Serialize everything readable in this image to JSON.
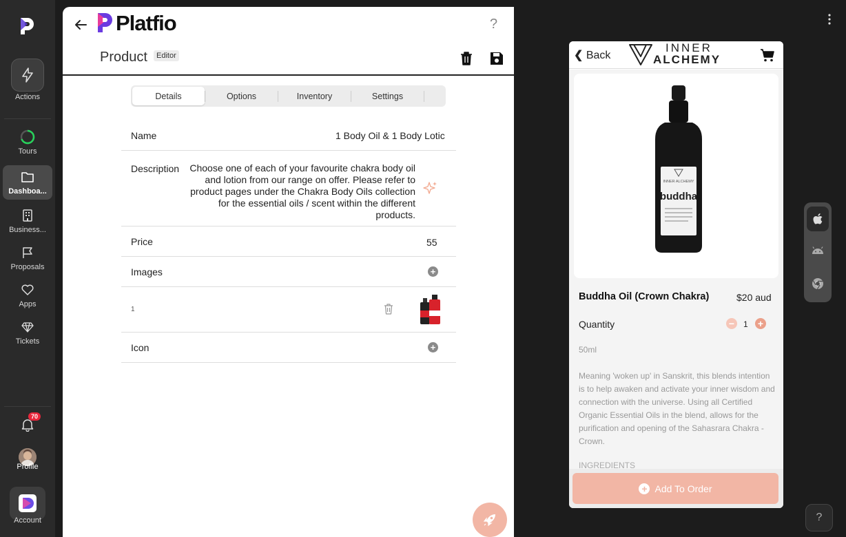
{
  "app": {
    "name": "Platfio"
  },
  "sidebar": {
    "items": [
      {
        "label": "Actions",
        "icon": "lightning-icon"
      },
      {
        "label": "Tours",
        "icon": "progress-ring-icon"
      },
      {
        "label": "Dashboa...",
        "icon": "folder-icon"
      },
      {
        "label": "Business...",
        "icon": "building-icon"
      },
      {
        "label": "Proposals",
        "icon": "flag-icon"
      },
      {
        "label": "Apps",
        "icon": "heart-icon"
      },
      {
        "label": "Tickets",
        "icon": "diamond-icon"
      }
    ],
    "notifications_count": "70",
    "profile_label": "Profile",
    "account_label": "Account"
  },
  "editor": {
    "title": "Product",
    "tag": "Editor",
    "help": "?",
    "tabs": [
      {
        "label": "Details"
      },
      {
        "label": "Options"
      },
      {
        "label": "Inventory"
      },
      {
        "label": "Settings"
      }
    ],
    "fields": {
      "name_label": "Name",
      "name_value": "1 Body Oil & 1 Body Lotic",
      "description_label": "Description",
      "description_value": "Choose one of each of your favourite chakra body oil and lotion from our range on offer. Please refer to product pages under the Chakra Body Oils collection for the essential oils / scent within the different products.",
      "price_label": "Price",
      "price_value": "55",
      "images_label": "Images",
      "image_index": "1",
      "icon_label": "Icon"
    }
  },
  "preview": {
    "back": "Back",
    "brand_line1": "INNER",
    "brand_line2": "ALCHEMY",
    "bottle_brand": "INNER ALCHEMY",
    "bottle_name": "buddha",
    "product_name": "Buddha Oil (Crown Chakra)",
    "price": "$20 aud",
    "quantity_label": "Quantity",
    "quantity": "1",
    "size": "50ml",
    "description": "Meaning 'woken up' in Sanskrit, this blends intention is to help awaken and activate your inner wisdom and connection with the universe. Using all Certified Organic Essential Oils in the blend, allows for the purification and opening of the Sahasrara Chakra - Crown.",
    "ingredients_heading": "INGREDIENTS",
    "add_button": "Add To Order"
  },
  "platform_switcher": [
    "apple-icon",
    "android-icon",
    "chrome-icon"
  ],
  "help_button": "?",
  "colors": {
    "accent": "#f2b6a5",
    "sidebar_bg": "#2a2a2a",
    "badge": "#e8263b"
  }
}
